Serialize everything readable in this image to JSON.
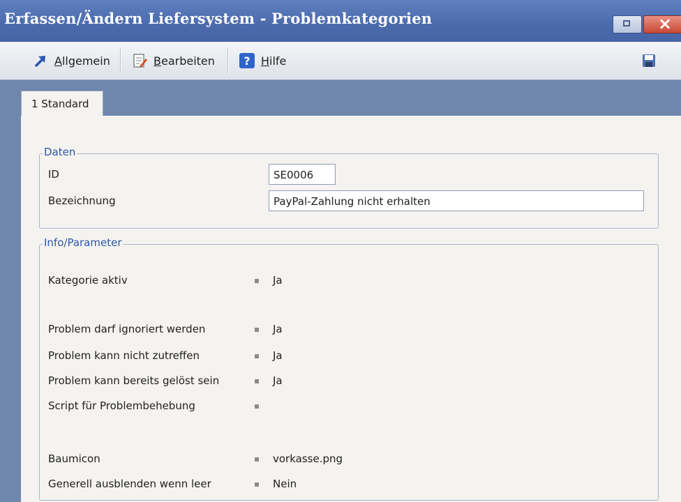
{
  "window": {
    "title": "Erfassen/Ändern Liefersystem - Problemkategorien"
  },
  "toolbar": {
    "allgemein": {
      "first": "A",
      "rest": "llgemein"
    },
    "bearbeiten": {
      "first": "B",
      "rest": "earbeiten"
    },
    "hilfe": {
      "first": "H",
      "rest": "ilfe"
    }
  },
  "tabs": [
    {
      "label": "1 Standard"
    }
  ],
  "daten": {
    "legend": "Daten",
    "id_label": "ID",
    "id_value": "SE0006",
    "bez_label": "Bezeichnung",
    "bez_value": "PayPal-Zahlung nicht erhalten"
  },
  "info": {
    "legend": "Info/Parameter",
    "rows": [
      {
        "label": "Kategorie aktiv",
        "value": "Ja"
      },
      {
        "label": "Problem darf ignoriert werden",
        "value": "Ja"
      },
      {
        "label": "Problem kann nicht zutreffen",
        "value": "Ja"
      },
      {
        "label": "Problem kann bereits gelöst sein",
        "value": "Ja"
      },
      {
        "label": "Script für Problembehebung",
        "value": ""
      },
      {
        "label": "Baumicon",
        "value": "vorkasse.png"
      },
      {
        "label": "Generell ausblenden wenn leer",
        "value": "Nein"
      }
    ]
  },
  "icons": {
    "allgemein": "arrow-up-right-icon",
    "bearbeiten": "edit-document-icon",
    "hilfe": "help-icon",
    "save": "save-disk-icon"
  },
  "colors": {
    "title_bar": "#4a6aac",
    "legend_text": "#2b56a6",
    "panel_bg": "#f5f3f0"
  }
}
